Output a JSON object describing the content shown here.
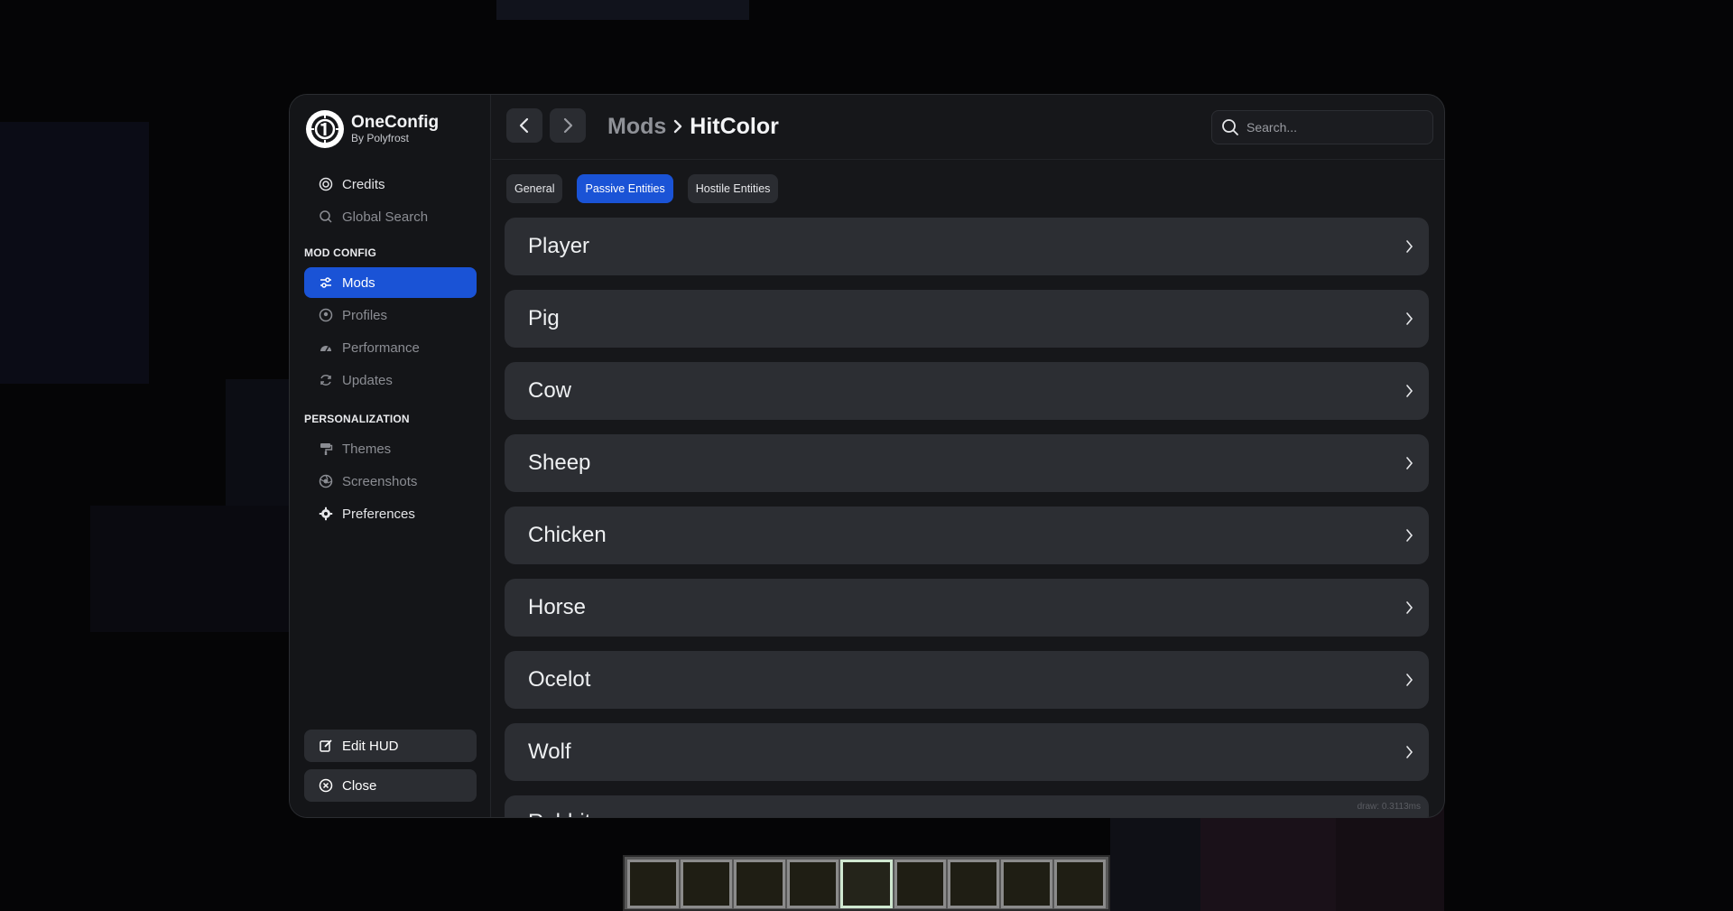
{
  "brand": {
    "name": "OneConfig",
    "subtitle": "By Polyfrost"
  },
  "sidebar": {
    "top_items": [
      {
        "label": "Credits",
        "icon": "credits-icon"
      },
      {
        "label": "Global Search",
        "icon": "search-icon"
      }
    ],
    "mod_config_label": "MOD CONFIG",
    "mod_config_items": [
      {
        "label": "Mods",
        "icon": "sliders-icon",
        "active": true
      },
      {
        "label": "Profiles",
        "icon": "profiles-icon"
      },
      {
        "label": "Performance",
        "icon": "gauge-icon"
      },
      {
        "label": "Updates",
        "icon": "refresh-icon"
      }
    ],
    "personalization_label": "PERSONALIZATION",
    "personalization_items": [
      {
        "label": "Themes",
        "icon": "paint-roller-icon"
      },
      {
        "label": "Screenshots",
        "icon": "aperture-icon"
      },
      {
        "label": "Preferences",
        "icon": "gear-icon"
      }
    ],
    "edit_hud_label": "Edit HUD",
    "close_label": "Close"
  },
  "header": {
    "breadcrumb_parent": "Mods",
    "breadcrumb_current": "HitColor",
    "search_placeholder": "Search..."
  },
  "tabs": [
    {
      "label": "General",
      "active": false
    },
    {
      "label": "Passive Entities",
      "active": true
    },
    {
      "label": "Hostile Entities",
      "active": false
    }
  ],
  "entities": [
    "Player",
    "Pig",
    "Cow",
    "Sheep",
    "Chicken",
    "Horse",
    "Ocelot",
    "Wolf",
    "Rabbit"
  ],
  "draw_time": "draw: 0.3113ms",
  "colors": {
    "accent": "#1a53d6",
    "panel": "#16171a",
    "row": "#2c2e33"
  }
}
